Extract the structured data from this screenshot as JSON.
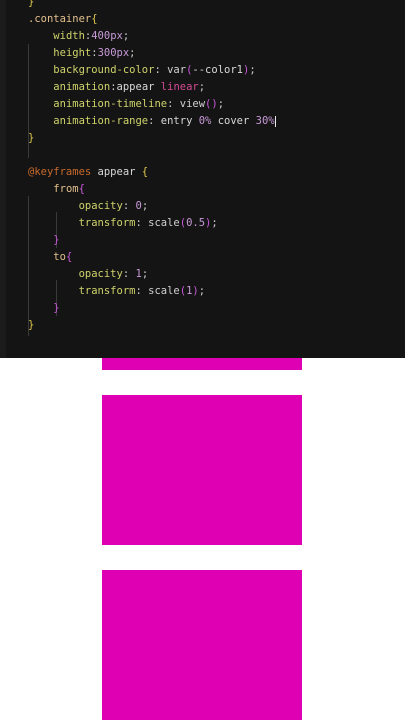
{
  "editor": {
    "lines": [
      {
        "indent": "",
        "tokens": [
          {
            "t": "}",
            "c": "tok-brace"
          }
        ]
      },
      {
        "indent": "",
        "tokens": [
          {
            "t": ".container",
            "c": "tok-sel"
          },
          {
            "t": "{",
            "c": "tok-brace"
          }
        ]
      },
      {
        "indent": "    ",
        "tokens": [
          {
            "t": "width",
            "c": "tok-prop"
          },
          {
            "t": ":",
            "c": "tok-punct"
          },
          {
            "t": "400px",
            "c": "tok-num"
          },
          {
            "t": ";",
            "c": "tok-punct"
          }
        ]
      },
      {
        "indent": "    ",
        "tokens": [
          {
            "t": "height",
            "c": "tok-prop"
          },
          {
            "t": ":",
            "c": "tok-punct"
          },
          {
            "t": "300px",
            "c": "tok-num"
          },
          {
            "t": ";",
            "c": "tok-punct"
          }
        ]
      },
      {
        "indent": "    ",
        "tokens": [
          {
            "t": "background-color",
            "c": "tok-prop"
          },
          {
            "t": ": ",
            "c": "tok-punct"
          },
          {
            "t": "var",
            "c": "tok-fn"
          },
          {
            "t": "(",
            "c": "tok-brace2"
          },
          {
            "t": "--color1",
            "c": "tok-name"
          },
          {
            "t": ")",
            "c": "tok-brace2"
          },
          {
            "t": ";",
            "c": "tok-punct"
          }
        ]
      },
      {
        "indent": "    ",
        "tokens": [
          {
            "t": "animation",
            "c": "tok-prop"
          },
          {
            "t": ":",
            "c": "tok-punct"
          },
          {
            "t": "appear ",
            "c": "tok-name"
          },
          {
            "t": "linear",
            "c": "tok-kw"
          },
          {
            "t": ";",
            "c": "tok-punct"
          }
        ]
      },
      {
        "indent": "    ",
        "tokens": [
          {
            "t": "animation-timeline",
            "c": "tok-prop"
          },
          {
            "t": ": ",
            "c": "tok-punct"
          },
          {
            "t": "view",
            "c": "tok-fn"
          },
          {
            "t": "()",
            "c": "tok-brace2"
          },
          {
            "t": ";",
            "c": "tok-punct"
          }
        ]
      },
      {
        "indent": "    ",
        "tokens": [
          {
            "t": "animation-range",
            "c": "tok-prop"
          },
          {
            "t": ": ",
            "c": "tok-punct"
          },
          {
            "t": "entry ",
            "c": "tok-name"
          },
          {
            "t": "0%",
            "c": "tok-num"
          },
          {
            "t": " cover ",
            "c": "tok-name"
          },
          {
            "t": "30%",
            "c": "tok-num"
          },
          {
            "t": "|",
            "c": "cursor-mark"
          }
        ]
      },
      {
        "indent": "",
        "tokens": [
          {
            "t": "}",
            "c": "tok-brace"
          }
        ]
      },
      {
        "indent": "",
        "tokens": []
      },
      {
        "indent": "",
        "tokens": [
          {
            "t": "@keyframes",
            "c": "tok-at"
          },
          {
            "t": " appear ",
            "c": "tok-name"
          },
          {
            "t": "{",
            "c": "tok-brace"
          }
        ]
      },
      {
        "indent": "    ",
        "tokens": [
          {
            "t": "from",
            "c": "tok-sel"
          },
          {
            "t": "{",
            "c": "tok-brace2"
          }
        ]
      },
      {
        "indent": "        ",
        "tokens": [
          {
            "t": "opacity",
            "c": "tok-prop"
          },
          {
            "t": ": ",
            "c": "tok-punct"
          },
          {
            "t": "0",
            "c": "tok-num"
          },
          {
            "t": ";",
            "c": "tok-punct"
          }
        ]
      },
      {
        "indent": "        ",
        "tokens": [
          {
            "t": "transform",
            "c": "tok-prop"
          },
          {
            "t": ": ",
            "c": "tok-punct"
          },
          {
            "t": "scale",
            "c": "tok-fn"
          },
          {
            "t": "(",
            "c": "tok-brace2"
          },
          {
            "t": "0.5",
            "c": "tok-num"
          },
          {
            "t": ")",
            "c": "tok-brace2"
          },
          {
            "t": ";",
            "c": "tok-punct"
          }
        ]
      },
      {
        "indent": "    ",
        "tokens": [
          {
            "t": "}",
            "c": "tok-brace2"
          }
        ]
      },
      {
        "indent": "    ",
        "tokens": [
          {
            "t": "to",
            "c": "tok-sel"
          },
          {
            "t": "{",
            "c": "tok-brace2"
          }
        ]
      },
      {
        "indent": "        ",
        "tokens": [
          {
            "t": "opacity",
            "c": "tok-prop"
          },
          {
            "t": ": ",
            "c": "tok-punct"
          },
          {
            "t": "1",
            "c": "tok-num"
          },
          {
            "t": ";",
            "c": "tok-punct"
          }
        ]
      },
      {
        "indent": "        ",
        "tokens": [
          {
            "t": "transform",
            "c": "tok-prop"
          },
          {
            "t": ": ",
            "c": "tok-punct"
          },
          {
            "t": "scale",
            "c": "tok-fn"
          },
          {
            "t": "(",
            "c": "tok-brace2"
          },
          {
            "t": "1",
            "c": "tok-num"
          },
          {
            "t": ")",
            "c": "tok-brace2"
          },
          {
            "t": ";",
            "c": "tok-punct"
          }
        ]
      },
      {
        "indent": "    ",
        "tokens": [
          {
            "t": "}",
            "c": "tok-brace2"
          }
        ]
      },
      {
        "indent": "",
        "tokens": [
          {
            "t": "}",
            "c": "tok-brace"
          }
        ]
      }
    ]
  },
  "preview": {
    "box_color": "#e000b3",
    "boxes": [
      "box-1",
      "box-2",
      "box-3"
    ]
  }
}
